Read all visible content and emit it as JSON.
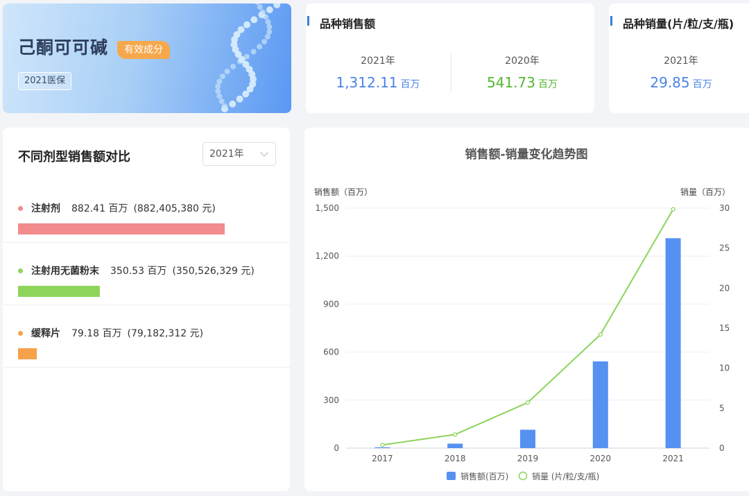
{
  "hero": {
    "title": "己酮可可碱",
    "tag": "有效成分",
    "badge": "2021医保"
  },
  "sales_card": {
    "title": "品种销售额",
    "items": [
      {
        "year": "2021年",
        "value": "1,312.11",
        "unit": "百万",
        "color": "#4a83e8"
      },
      {
        "year": "2020年",
        "value": "541.73",
        "unit": "百万",
        "color": "#52b62c"
      }
    ]
  },
  "volume_card": {
    "title": "品种销量(片/粒/支/瓶)",
    "items": [
      {
        "year": "2021年",
        "value": "29.85",
        "unit": "百万",
        "color": "#4a83e8"
      }
    ]
  },
  "dosage": {
    "title": "不同剂型销售额对比",
    "year_select": "2021年",
    "rows": [
      {
        "name": "注射剂",
        "amount": "882.41 百万",
        "full": "(882,405,380 元)",
        "value": 882.41,
        "color": "#f28b8b"
      },
      {
        "name": "注射用无菌粉末",
        "amount": "350.53 百万",
        "full": "(350,526,329 元)",
        "value": 350.53,
        "color": "#8fd45a"
      },
      {
        "name": "缓释片",
        "amount": "79.18 百万",
        "full": "(79,182,312 元)",
        "value": 79.18,
        "color": "#f5a24b"
      }
    ]
  },
  "chart_data": {
    "type": "bar",
    "title": "销售额-销量变化趋势图",
    "ylabel": "销售额（百万）",
    "ylabel_right": "销量（百万）",
    "categories": [
      "2017",
      "2018",
      "2019",
      "2020",
      "2021"
    ],
    "ylim": [
      0,
      1500
    ],
    "ylim_right": [
      0,
      30
    ],
    "y_ticks": [
      "0",
      "300",
      "600",
      "900",
      "1,200",
      "1,500"
    ],
    "y_right_ticks": [
      "0",
      "5",
      "10",
      "15",
      "20",
      "25",
      "30"
    ],
    "legend_position": "bottom-center",
    "series": [
      {
        "name": "销售额(百万)",
        "type": "bar",
        "axis": "left",
        "color": "#5591f0",
        "values": [
          5,
          28,
          115,
          542,
          1312
        ]
      },
      {
        "name": "销量 (片/粒/支/瓶)",
        "type": "line",
        "axis": "right",
        "color": "#8bd45b",
        "values": [
          0.4,
          1.7,
          5.7,
          14.2,
          29.85
        ]
      }
    ]
  }
}
